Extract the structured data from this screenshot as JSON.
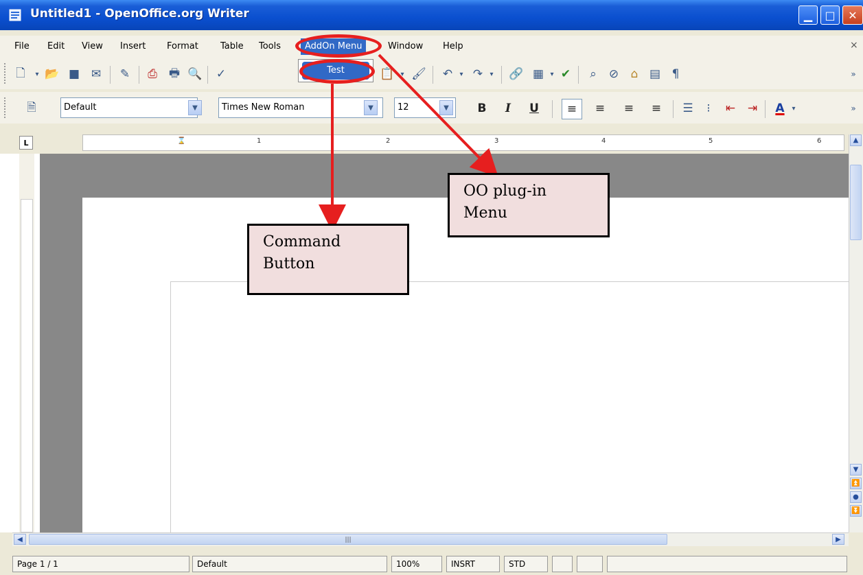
{
  "window": {
    "title": "Untitled1 - OpenOffice.org Writer",
    "controls": {
      "minimize": "▁",
      "maximize": "□",
      "close": "✕"
    }
  },
  "menubar": {
    "items": [
      "File",
      "Edit",
      "View",
      "Insert",
      "Format",
      "Table",
      "Tools",
      "AddOn Menu",
      "Window",
      "Help"
    ],
    "close_glyph": "×"
  },
  "addon_dropdown": {
    "items": [
      "Test"
    ]
  },
  "formatting": {
    "paragraph_style": "Default",
    "font_name": "Times New Roman",
    "font_size": "12",
    "bold": "B",
    "italic": "I",
    "underline": "U",
    "font_color_label": "A"
  },
  "ruler": {
    "corner": "L",
    "ticks": [
      "1",
      "2",
      "3",
      "4",
      "5",
      "6"
    ]
  },
  "status": {
    "page": "Page 1 / 1",
    "style": "Default",
    "zoom": "100%",
    "insert_mode": "INSRT",
    "selection_mode": "STD"
  },
  "annotations": {
    "command_button": {
      "line1": "Command",
      "line2": "Button"
    },
    "oo_plugin_menu": {
      "line1": "OO plug-in",
      "line2": "Menu"
    }
  },
  "colors": {
    "titlebar": "#0a4fcf",
    "menu_highlight": "#3169c6",
    "annotation_red": "#e61f1f",
    "annotation_fill": "#f1dede"
  }
}
